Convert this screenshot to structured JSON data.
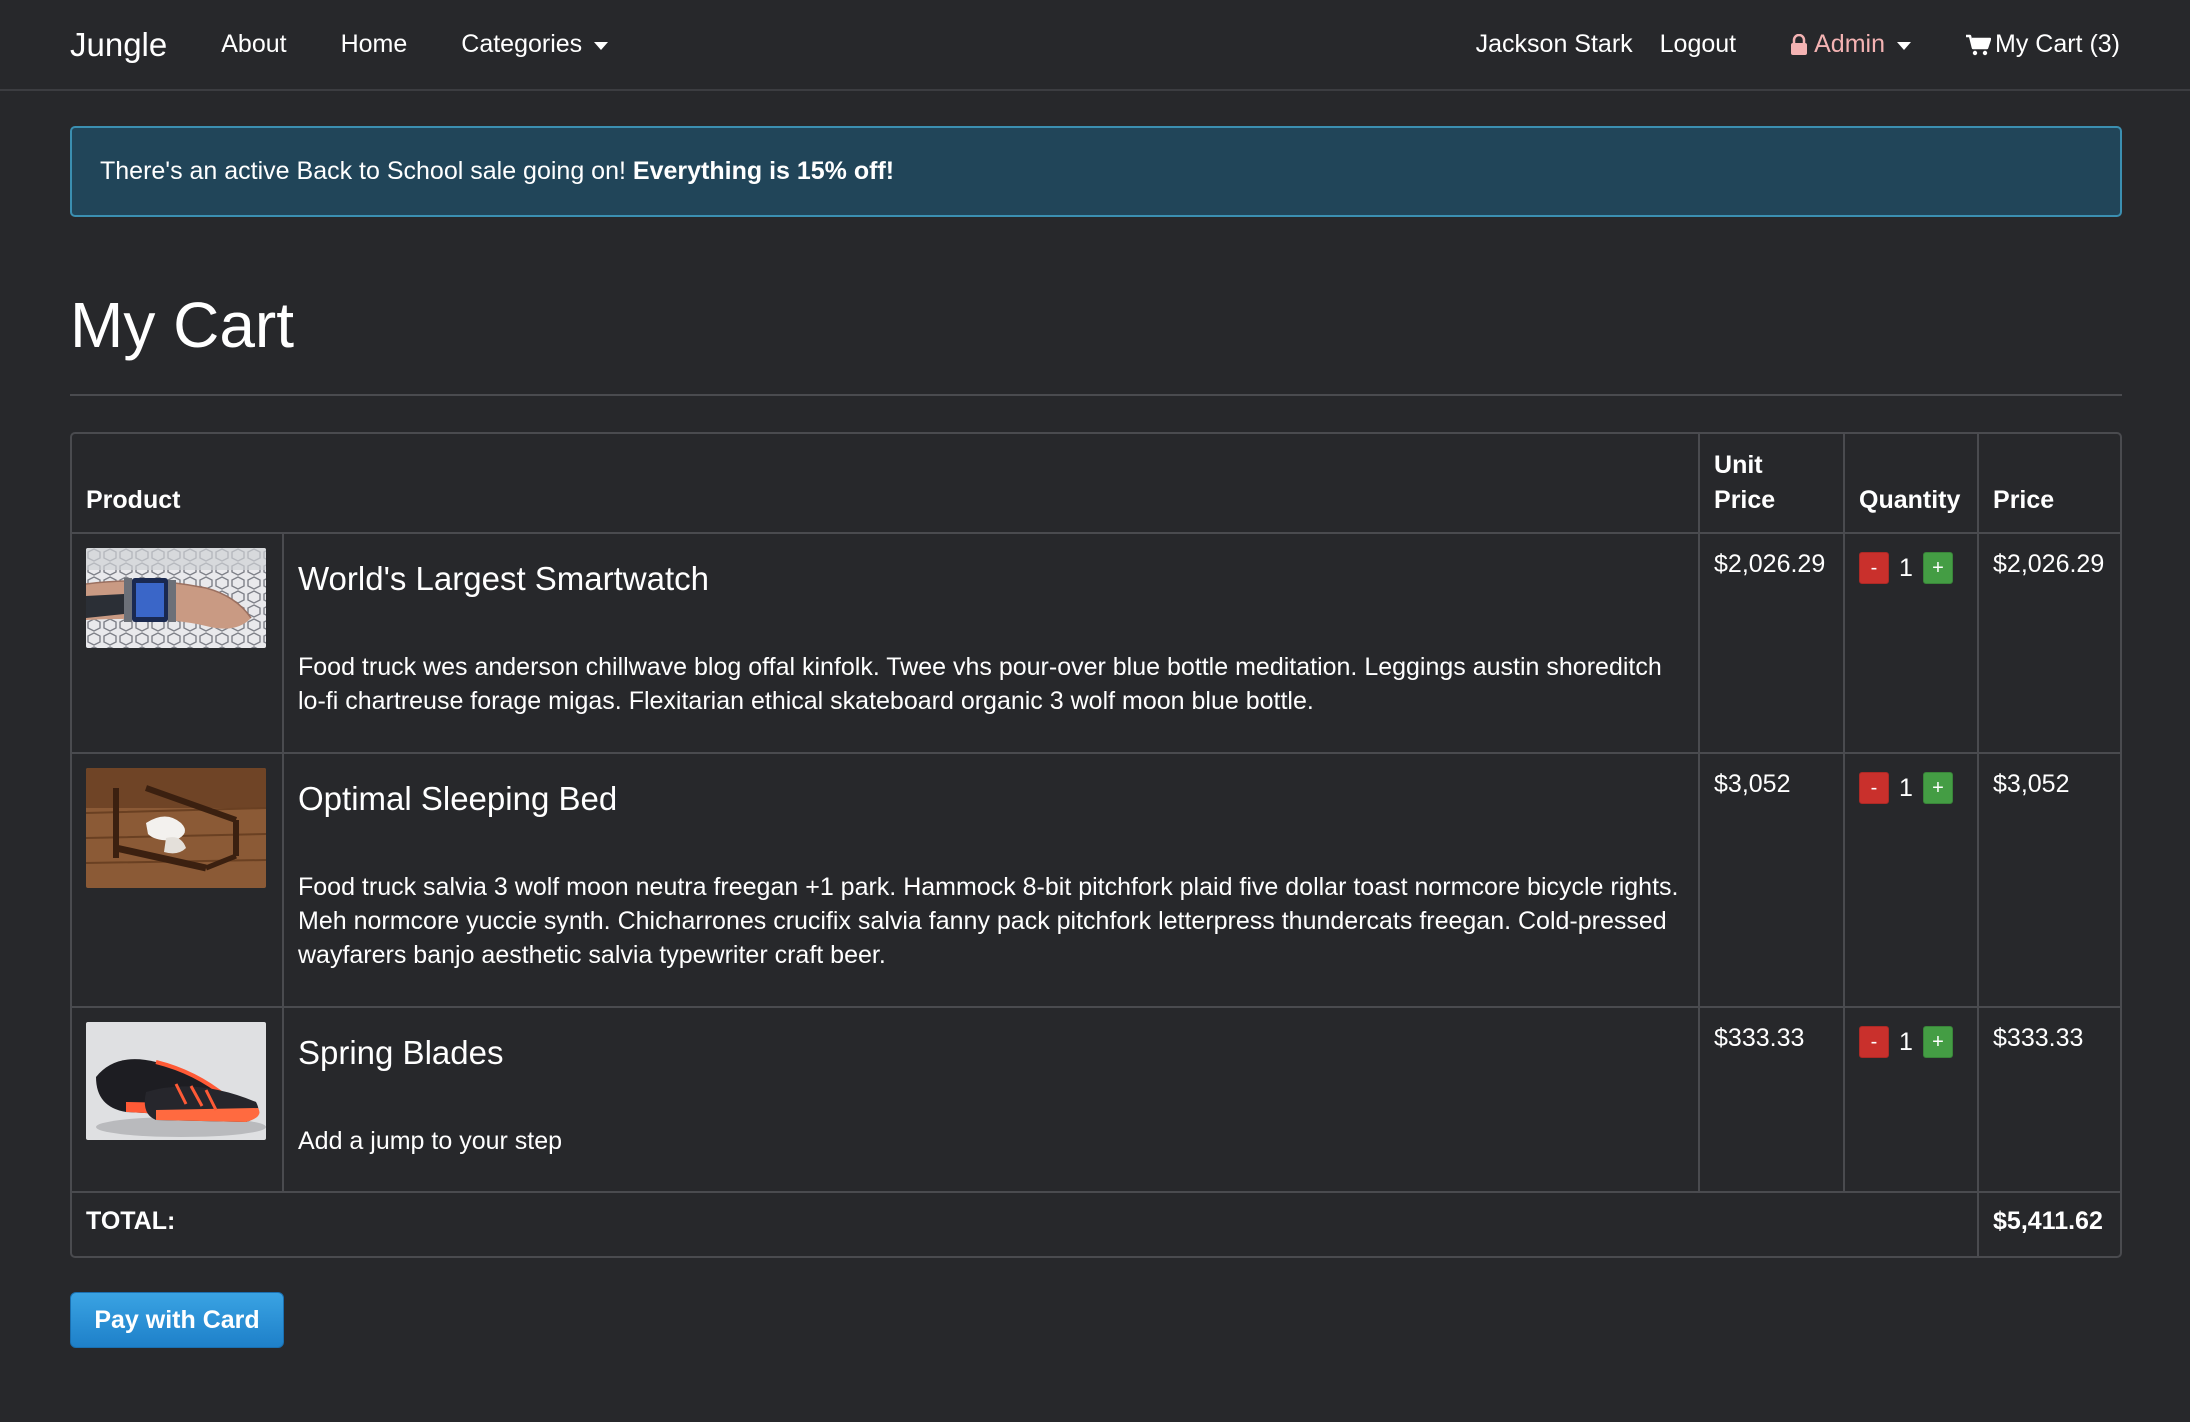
{
  "nav": {
    "brand": "Jungle",
    "about": "About",
    "home": "Home",
    "categories": "Categories",
    "user": "Jackson Stark",
    "logout": "Logout",
    "admin": "Admin",
    "cart": "My Cart (3)"
  },
  "alert": {
    "text": "There's an active Back to School sale going on!",
    "emphasis": "Everything is 15% off!"
  },
  "page": {
    "title": "My Cart"
  },
  "table": {
    "headers": {
      "product": "Product",
      "unit_price_1": "Unit",
      "unit_price_2": "Price",
      "quantity": "Quantity",
      "price": "Price"
    },
    "items": [
      {
        "name": "World's Largest Smartwatch",
        "description": "Food truck wes anderson chillwave blog offal kinfolk. Twee vhs pour-over blue bottle meditation. Leggings austin shoreditch lo-fi chartreuse forage migas. Flexitarian ethical skateboard organic 3 wolf moon blue bottle.",
        "unit_price": "$2,026.29",
        "quantity": "1",
        "price": "$2,026.29"
      },
      {
        "name": "Optimal Sleeping Bed",
        "description": "Food truck salvia 3 wolf moon neutra freegan +1 park. Hammock 8-bit pitchfork plaid five dollar toast normcore bicycle rights. Meh normcore yuccie synth. Chicharrones crucifix salvia fanny pack pitchfork letterpress thundercats freegan. Cold-pressed wayfarers banjo aesthetic salvia typewriter craft beer.",
        "unit_price": "$3,052",
        "quantity": "1",
        "price": "$3,052"
      },
      {
        "name": "Spring Blades",
        "description": "Add a jump to your step",
        "unit_price": "$333.33",
        "quantity": "1",
        "price": "$333.33"
      }
    ],
    "minus_label": "-",
    "plus_label": "+",
    "total_label": "TOTAL:",
    "total_value": "$5,411.62"
  },
  "pay_button": "Pay with Card",
  "icons": {
    "lock": "lock-icon",
    "cart": "shopping-cart-icon",
    "caret": "chevron-down-icon"
  },
  "colors": {
    "background": "#27282b",
    "alert_bg": "#214559",
    "minus": "#c9302c",
    "plus": "#449d44",
    "pay": "#2a8fd6"
  }
}
